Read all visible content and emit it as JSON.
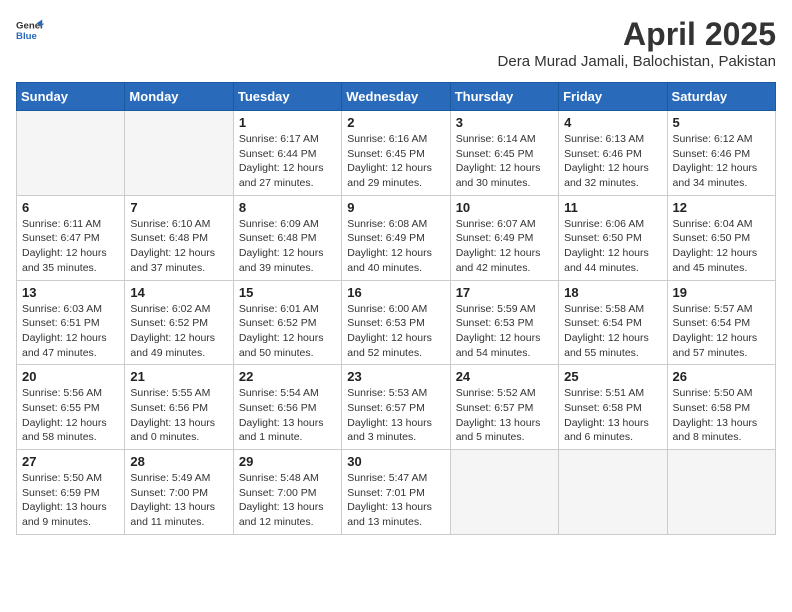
{
  "header": {
    "logo_line1": "General",
    "logo_line2": "Blue",
    "month_title": "April 2025",
    "location": "Dera Murad Jamali, Balochistan, Pakistan"
  },
  "days_of_week": [
    "Sunday",
    "Monday",
    "Tuesday",
    "Wednesday",
    "Thursday",
    "Friday",
    "Saturday"
  ],
  "weeks": [
    [
      {
        "day": "",
        "details": ""
      },
      {
        "day": "",
        "details": ""
      },
      {
        "day": "1",
        "details": "Sunrise: 6:17 AM\nSunset: 6:44 PM\nDaylight: 12 hours and 27 minutes."
      },
      {
        "day": "2",
        "details": "Sunrise: 6:16 AM\nSunset: 6:45 PM\nDaylight: 12 hours and 29 minutes."
      },
      {
        "day": "3",
        "details": "Sunrise: 6:14 AM\nSunset: 6:45 PM\nDaylight: 12 hours and 30 minutes."
      },
      {
        "day": "4",
        "details": "Sunrise: 6:13 AM\nSunset: 6:46 PM\nDaylight: 12 hours and 32 minutes."
      },
      {
        "day": "5",
        "details": "Sunrise: 6:12 AM\nSunset: 6:46 PM\nDaylight: 12 hours and 34 minutes."
      }
    ],
    [
      {
        "day": "6",
        "details": "Sunrise: 6:11 AM\nSunset: 6:47 PM\nDaylight: 12 hours and 35 minutes."
      },
      {
        "day": "7",
        "details": "Sunrise: 6:10 AM\nSunset: 6:48 PM\nDaylight: 12 hours and 37 minutes."
      },
      {
        "day": "8",
        "details": "Sunrise: 6:09 AM\nSunset: 6:48 PM\nDaylight: 12 hours and 39 minutes."
      },
      {
        "day": "9",
        "details": "Sunrise: 6:08 AM\nSunset: 6:49 PM\nDaylight: 12 hours and 40 minutes."
      },
      {
        "day": "10",
        "details": "Sunrise: 6:07 AM\nSunset: 6:49 PM\nDaylight: 12 hours and 42 minutes."
      },
      {
        "day": "11",
        "details": "Sunrise: 6:06 AM\nSunset: 6:50 PM\nDaylight: 12 hours and 44 minutes."
      },
      {
        "day": "12",
        "details": "Sunrise: 6:04 AM\nSunset: 6:50 PM\nDaylight: 12 hours and 45 minutes."
      }
    ],
    [
      {
        "day": "13",
        "details": "Sunrise: 6:03 AM\nSunset: 6:51 PM\nDaylight: 12 hours and 47 minutes."
      },
      {
        "day": "14",
        "details": "Sunrise: 6:02 AM\nSunset: 6:52 PM\nDaylight: 12 hours and 49 minutes."
      },
      {
        "day": "15",
        "details": "Sunrise: 6:01 AM\nSunset: 6:52 PM\nDaylight: 12 hours and 50 minutes."
      },
      {
        "day": "16",
        "details": "Sunrise: 6:00 AM\nSunset: 6:53 PM\nDaylight: 12 hours and 52 minutes."
      },
      {
        "day": "17",
        "details": "Sunrise: 5:59 AM\nSunset: 6:53 PM\nDaylight: 12 hours and 54 minutes."
      },
      {
        "day": "18",
        "details": "Sunrise: 5:58 AM\nSunset: 6:54 PM\nDaylight: 12 hours and 55 minutes."
      },
      {
        "day": "19",
        "details": "Sunrise: 5:57 AM\nSunset: 6:54 PM\nDaylight: 12 hours and 57 minutes."
      }
    ],
    [
      {
        "day": "20",
        "details": "Sunrise: 5:56 AM\nSunset: 6:55 PM\nDaylight: 12 hours and 58 minutes."
      },
      {
        "day": "21",
        "details": "Sunrise: 5:55 AM\nSunset: 6:56 PM\nDaylight: 13 hours and 0 minutes."
      },
      {
        "day": "22",
        "details": "Sunrise: 5:54 AM\nSunset: 6:56 PM\nDaylight: 13 hours and 1 minute."
      },
      {
        "day": "23",
        "details": "Sunrise: 5:53 AM\nSunset: 6:57 PM\nDaylight: 13 hours and 3 minutes."
      },
      {
        "day": "24",
        "details": "Sunrise: 5:52 AM\nSunset: 6:57 PM\nDaylight: 13 hours and 5 minutes."
      },
      {
        "day": "25",
        "details": "Sunrise: 5:51 AM\nSunset: 6:58 PM\nDaylight: 13 hours and 6 minutes."
      },
      {
        "day": "26",
        "details": "Sunrise: 5:50 AM\nSunset: 6:58 PM\nDaylight: 13 hours and 8 minutes."
      }
    ],
    [
      {
        "day": "27",
        "details": "Sunrise: 5:50 AM\nSunset: 6:59 PM\nDaylight: 13 hours and 9 minutes."
      },
      {
        "day": "28",
        "details": "Sunrise: 5:49 AM\nSunset: 7:00 PM\nDaylight: 13 hours and 11 minutes."
      },
      {
        "day": "29",
        "details": "Sunrise: 5:48 AM\nSunset: 7:00 PM\nDaylight: 13 hours and 12 minutes."
      },
      {
        "day": "30",
        "details": "Sunrise: 5:47 AM\nSunset: 7:01 PM\nDaylight: 13 hours and 13 minutes."
      },
      {
        "day": "",
        "details": ""
      },
      {
        "day": "",
        "details": ""
      },
      {
        "day": "",
        "details": ""
      }
    ]
  ]
}
